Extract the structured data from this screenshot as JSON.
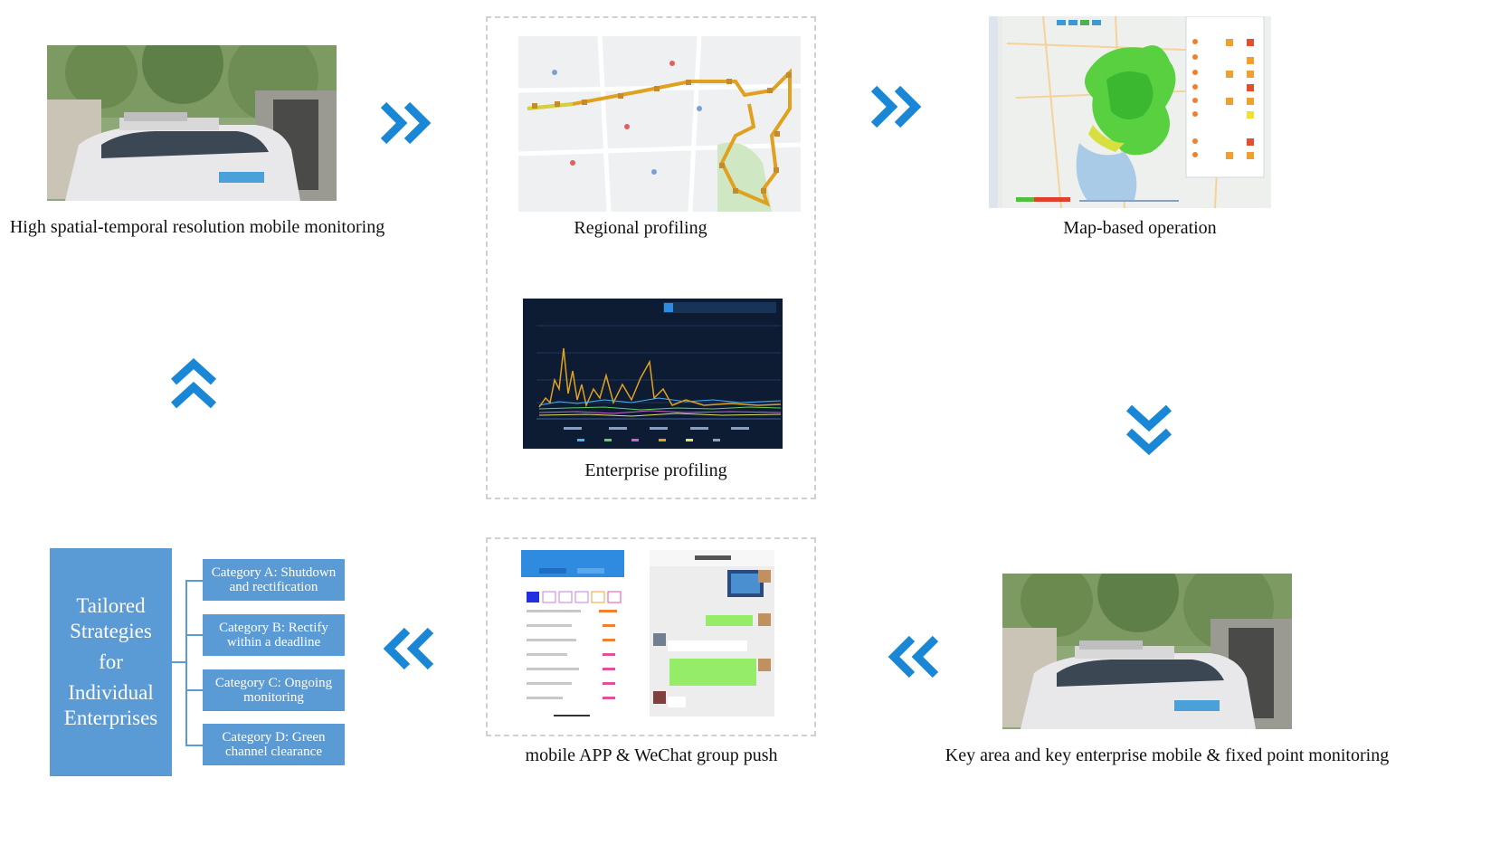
{
  "captions": {
    "mobile_monitoring": "High spatial-temporal resolution mobile monitoring",
    "regional_profiling": "Regional profiling",
    "map_operation": "Map-based operation",
    "enterprise_profiling": "Enterprise profiling",
    "app_push": "mobile APP & WeChat group push",
    "key_area": "Key area and key enterprise mobile & fixed point monitoring"
  },
  "strategies": {
    "title_lines": [
      "Tailored",
      "Strategies",
      "for",
      "Individual",
      "Enterprises"
    ],
    "categories": [
      {
        "line1": "Category A: Shutdown",
        "line2": "and rectification"
      },
      {
        "line1": "Category B: Rectify",
        "line2": "within a deadline"
      },
      {
        "line1": "Category C: Ongoing",
        "line2": "monitoring"
      },
      {
        "line1": "Category D: Green",
        "line2": "channel clearance"
      }
    ]
  },
  "colors": {
    "arrow": "#1a86d6",
    "strategy_box": "#5b9bd5",
    "route": "#e0a020",
    "chart_bg": "#0d1b33"
  },
  "icons": {
    "arrow_right": "double-chevron-right-icon",
    "arrow_down": "double-chevron-down-icon",
    "arrow_left": "double-chevron-left-icon",
    "arrow_up": "double-chevron-up-icon"
  }
}
